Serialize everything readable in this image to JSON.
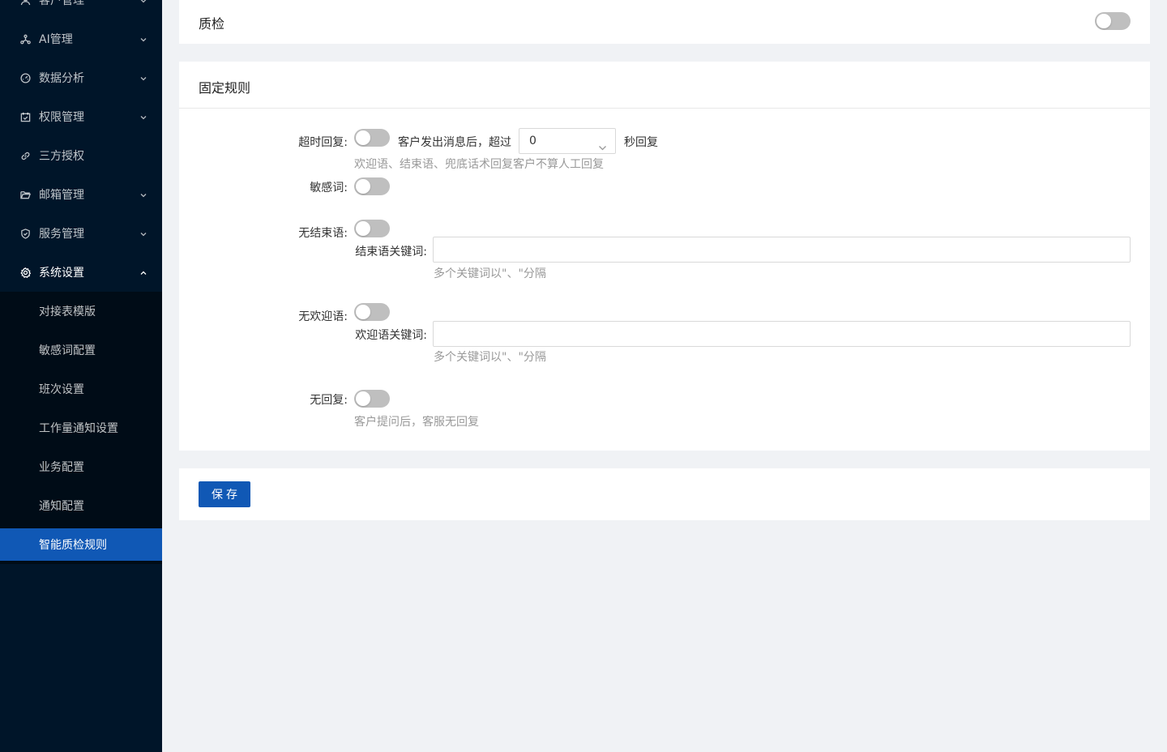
{
  "sidebar": {
    "menu": [
      {
        "label": "客户管理",
        "icon": "user-icon"
      },
      {
        "label": "AI管理",
        "icon": "ai-icon"
      },
      {
        "label": "数据分析",
        "icon": "dashboard-icon"
      },
      {
        "label": "权限管理",
        "icon": "calendar-check-icon"
      },
      {
        "label": "三方授权",
        "icon": "link-icon"
      },
      {
        "label": "邮箱管理",
        "icon": "folder-icon"
      },
      {
        "label": "服务管理",
        "icon": "shield-icon"
      },
      {
        "label": "系统设置",
        "icon": "gear-icon"
      }
    ],
    "submenu": [
      {
        "label": "对接表模版"
      },
      {
        "label": "敏感词配置"
      },
      {
        "label": "班次设置"
      },
      {
        "label": "工作量通知设置"
      },
      {
        "label": "业务配置"
      },
      {
        "label": "通知配置"
      },
      {
        "label": "智能质检规则",
        "active": true
      }
    ]
  },
  "quality_card": {
    "title": "质检",
    "enabled": false
  },
  "rules_card": {
    "title": "固定规则",
    "timeout": {
      "label": "超时回复:",
      "enabled": false,
      "prefix": "客户发出消息后，超过",
      "seconds_value": "0",
      "suffix": "秒回复",
      "hint": "欢迎语、结束语、兜底话术回复客户不算人工回复"
    },
    "sensitive": {
      "label": "敏感词:",
      "enabled": false
    },
    "no_closing": {
      "label": "无结束语:",
      "enabled": false,
      "keyword_label": "结束语关键词:",
      "keyword_value": "",
      "hint": "多个关键词以\"、\"分隔"
    },
    "no_welcome": {
      "label": "无欢迎语:",
      "enabled": false,
      "keyword_label": "欢迎语关键词:",
      "keyword_value": "",
      "hint": "多个关键词以\"、\"分隔"
    },
    "no_reply": {
      "label": "无回复:",
      "enabled": false,
      "hint": "客户提问后，客服无回复"
    }
  },
  "actions": {
    "save_label": "保存"
  },
  "colors": {
    "sidebar_bg": "#001529",
    "submenu_bg": "#000c17",
    "accent": "#1058b5",
    "switch_off": "#bfbfbf"
  }
}
